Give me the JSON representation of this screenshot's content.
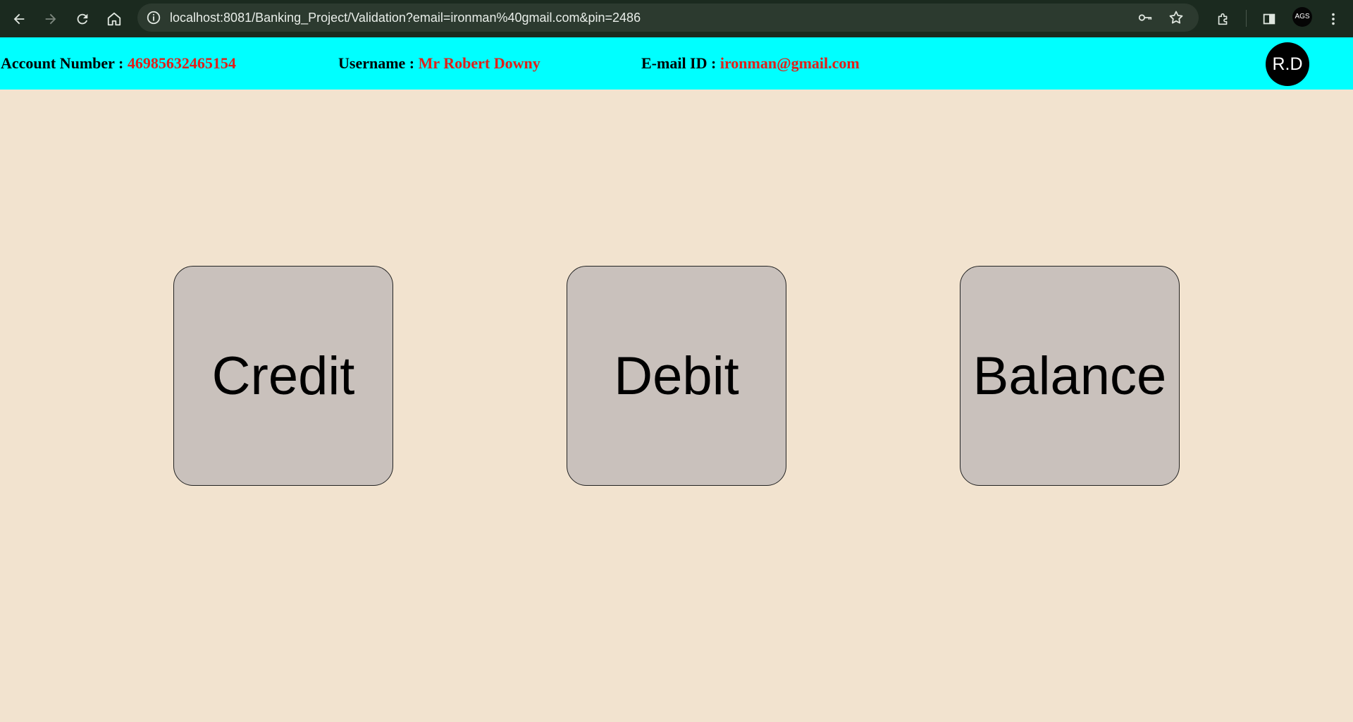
{
  "browser": {
    "url": "localhost:8081/Banking_Project/Validation?email=ironman%40gmail.com&pin=2486",
    "profile_initials": "AGS",
    "icons": {
      "back": "arrow-left-icon",
      "forward": "arrow-right-icon",
      "reload": "reload-icon",
      "home": "home-icon",
      "site_info": "info-icon",
      "password": "key-icon",
      "bookmark": "star-icon",
      "extensions": "puzzle-icon",
      "side_panel": "side-panel-icon",
      "menu": "kebab-menu-icon"
    }
  },
  "header": {
    "account_label": "Account Number : ",
    "account_value": "46985632465154",
    "username_label": "Username : ",
    "username_value": "Mr Robert Downy",
    "email_label": "E-mail ID : ",
    "email_value": "ironman@gmail.com",
    "avatar_initials": "R.D",
    "background_color": "#00ffff",
    "value_color": "#e0201a"
  },
  "actions": {
    "credit_label": "Credit",
    "debit_label": "Debit",
    "balance_label": "Balance"
  },
  "page": {
    "background_color": "#f2e3cf",
    "tile_color": "#c9c1bc"
  }
}
